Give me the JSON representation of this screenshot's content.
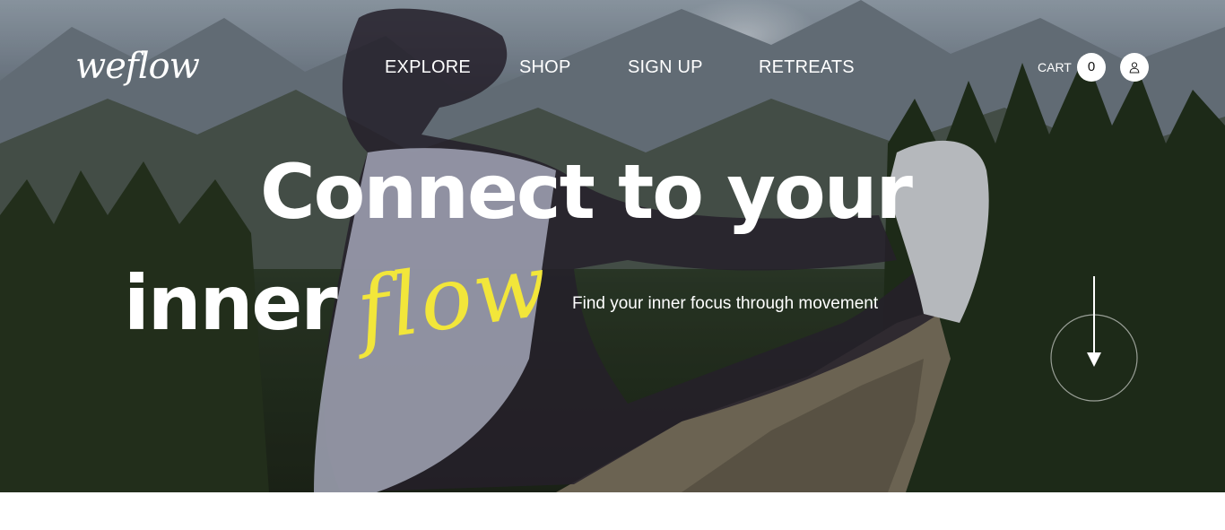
{
  "brand": {
    "logo_text": "weflow"
  },
  "nav": {
    "items": [
      "EXPLORE",
      "SHOP",
      "SIGN UP",
      "RETREATS"
    ]
  },
  "cart": {
    "label": "CART",
    "count": "0"
  },
  "hero": {
    "headline_line1": "Connect to your",
    "headline_line2": "inner",
    "headline_accent": "flow",
    "tagline": "Find your inner focus through movement"
  },
  "colors": {
    "accent": "#f2e63a",
    "text": "#ffffff"
  },
  "icons": {
    "account": "user-icon",
    "scroll": "arrow-down-icon"
  }
}
